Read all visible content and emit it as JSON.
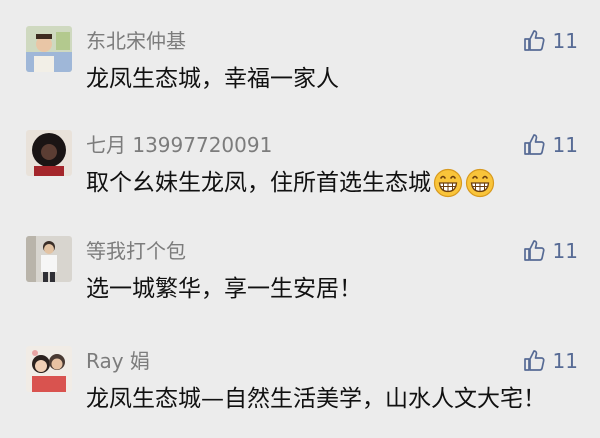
{
  "comments": [
    {
      "nickname": "东北宋仲基",
      "likes": "11",
      "text": "龙凤生态城，幸福一家人",
      "emojis": []
    },
    {
      "nickname": "七月 13997720091",
      "likes": "11",
      "text": "取个幺妹生龙凤，住所首选生态城",
      "emojis": [
        "grinning-face-emoji",
        "grinning-face-emoji"
      ]
    },
    {
      "nickname": "等我打个包",
      "likes": "11",
      "text": "选一城繁华，享一生安居！",
      "emojis": []
    },
    {
      "nickname": "Ray 娟",
      "likes": "11",
      "text": "龙凤生态城—自然生活美学，山水人文大宅！",
      "emojis": []
    }
  ],
  "colors": {
    "background": "#ececec",
    "nickname": "#7c7c7c",
    "like": "#576b95",
    "text": "#111111"
  }
}
